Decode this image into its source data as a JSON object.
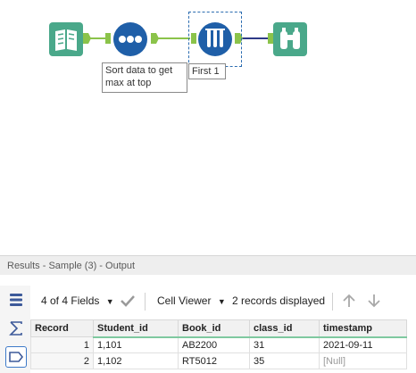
{
  "workflow": {
    "sort_annotation": "Sort data to get max at top",
    "first_annotation": "First 1"
  },
  "results": {
    "title": "Results - Sample (3) - Output",
    "fields_label": "4 of 4 Fields",
    "viewer_label": "Cell Viewer",
    "records_label": "2 records displayed"
  },
  "table": {
    "headers": [
      "Record",
      "Student_id",
      "Book_id",
      "class_id",
      "timestamp"
    ],
    "rows": [
      [
        "1",
        "1,101",
        "AB2200",
        "31",
        "2021-09-11"
      ],
      [
        "2",
        "1,102",
        "RT5012",
        "35",
        "[Null]"
      ]
    ]
  },
  "colors": {
    "input_green": "#4aa88a",
    "sort_blue": "#1f5fa8",
    "browse_green": "#4aa88a",
    "connector_green": "#8bc34a",
    "connector_blue": "#2e3a87"
  },
  "icons": [
    "book-icon",
    "three-dots-icon",
    "test-tubes-icon",
    "binoculars-icon",
    "rows-icon",
    "sum-icon",
    "tag-icon",
    "check-icon",
    "chevron-down-icon",
    "arrow-up-icon",
    "arrow-down-icon"
  ]
}
